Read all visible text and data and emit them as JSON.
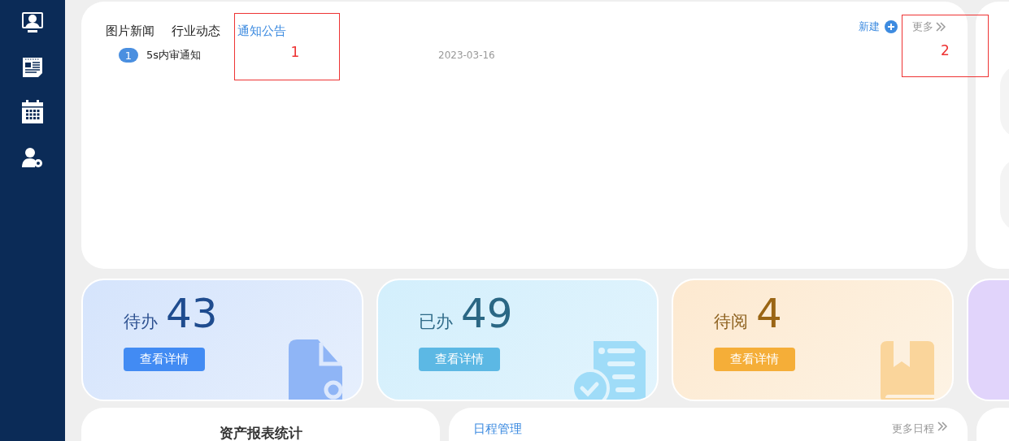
{
  "news_panel": {
    "tabs": [
      {
        "label": "图片新闻",
        "selected": false
      },
      {
        "label": "行业动态",
        "selected": false
      },
      {
        "label": "通知公告",
        "selected": true
      }
    ],
    "new_label": "新建",
    "more_label": "更多",
    "items": [
      {
        "index": "1",
        "title": "5s内审通知",
        "date": "2023-03-16"
      }
    ]
  },
  "annotations": [
    {
      "label": "1"
    },
    {
      "label": "2"
    }
  ],
  "stats": [
    {
      "kind": "todo",
      "label": "待办",
      "count": "43",
      "button": "查看详情"
    },
    {
      "kind": "done",
      "label": "已办",
      "count": "49",
      "button": "查看详情"
    },
    {
      "kind": "read",
      "label": "待阅",
      "count": "4",
      "button": "查看详情"
    },
    {
      "kind": "other"
    }
  ],
  "report": {
    "title": "资产报表统计"
  },
  "schedule": {
    "title": "日程管理",
    "more_label": "更多日程"
  }
}
